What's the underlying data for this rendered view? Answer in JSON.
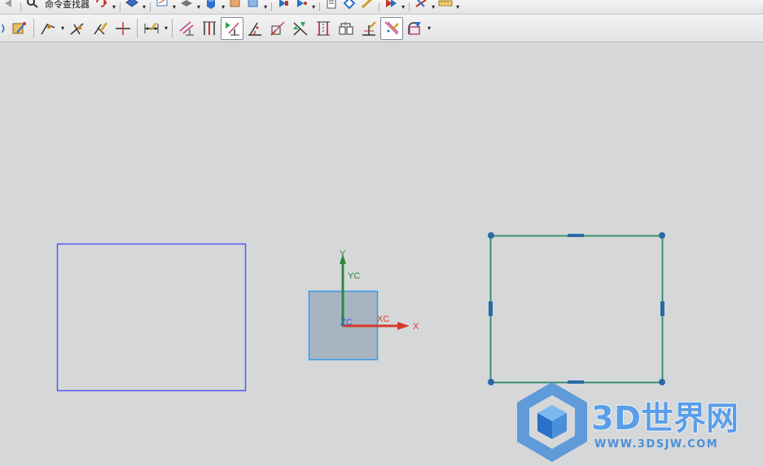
{
  "toolbar_top": {
    "command_finder_label": "命令查找器",
    "accent_color": "#2a6fc9"
  },
  "toolbar_bottom": {
    "tools": [
      "sketch-tool-icon",
      "profile-icon",
      "line-icon",
      "arc-icon",
      "trim-icon",
      "extend-icon",
      "dimension-icon",
      "constraint-icon",
      "perpendicular-icon",
      "vertical-icon",
      "horizontal-constraint-icon",
      "angle-constraint-icon",
      "tangent-icon",
      "fix-icon",
      "parallel-icon",
      "equal-length-icon",
      "concentric-icon",
      "auto-constrain-icon",
      "show-constraints-icon"
    ]
  },
  "canvas": {
    "axis_y_label": "Y",
    "axis_yc_label": "YC",
    "axis_xc_label": "XC",
    "axis_x_label": "X",
    "axis_zc_label": "ZC",
    "colors": {
      "left_rect": "#4e5cf0",
      "wcs_square_fill": "#a8b4c2",
      "wcs_square_stroke": "#3a9ae8",
      "y_axis": "#2a8a3a",
      "x_axis": "#d83a2a",
      "right_rect": "#2a8a6a",
      "right_rect_handles": "#2a6aa8"
    }
  },
  "watermark": {
    "brand": "3D世界网",
    "url": "WWW.3DSJW.COM"
  }
}
